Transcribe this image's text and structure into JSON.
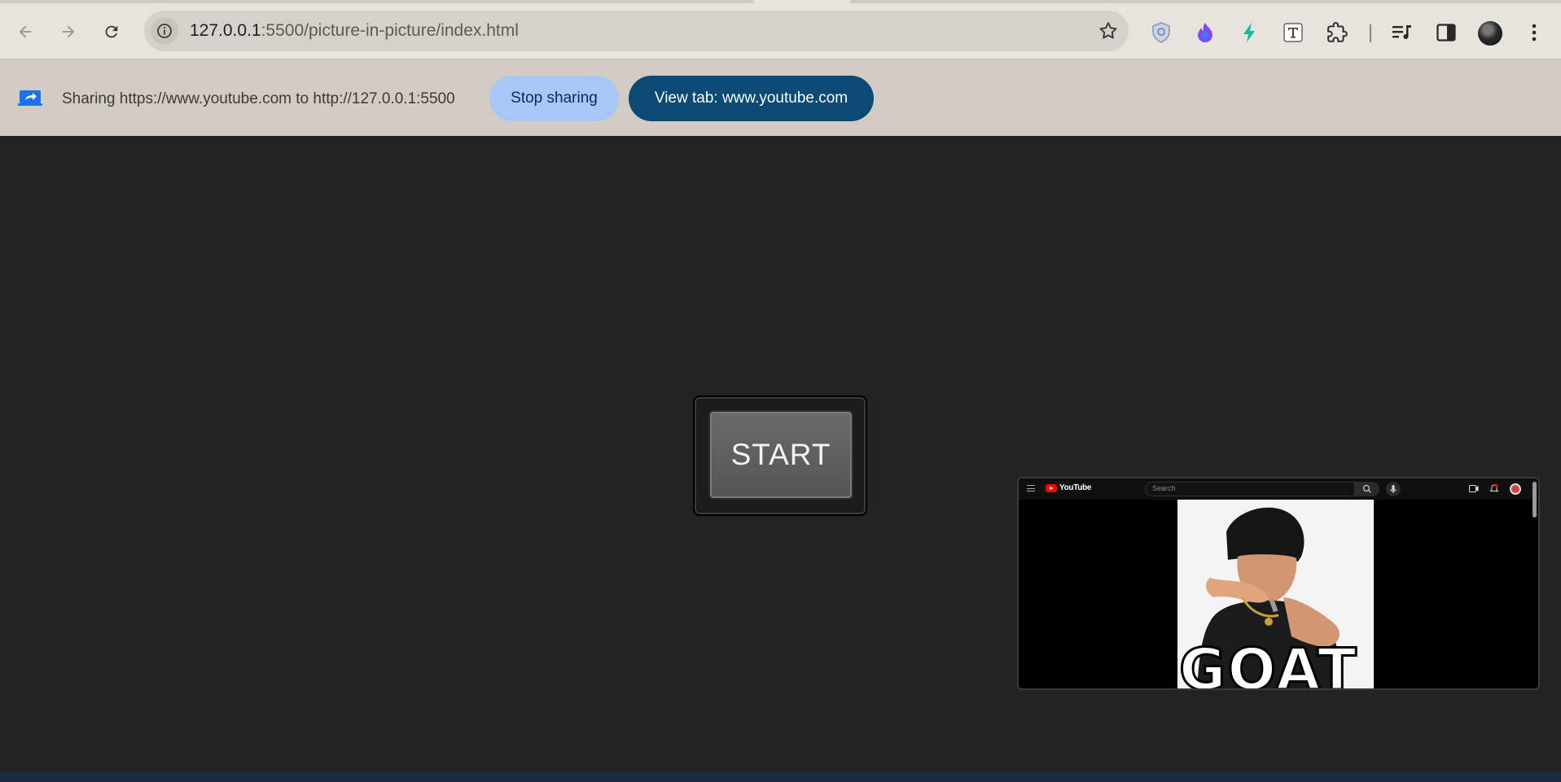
{
  "browser": {
    "url_host": "127.0.0.1",
    "url_rest": ":5500/picture-in-picture/index.html"
  },
  "infobar": {
    "sharing_text": "Sharing https://www.youtube.com to http://127.0.0.1:5500",
    "stop_label": "Stop sharing",
    "view_label": "View tab: www.youtube.com"
  },
  "main": {
    "start_label": "START"
  },
  "pip": {
    "yt_brand": "YouTube",
    "yt_search_placeholder": "Search",
    "thumbnail_text": "GOAT"
  },
  "icons": [
    "back-icon",
    "forward-icon",
    "reload-icon",
    "info-icon",
    "star-icon",
    "shield-extension-icon",
    "flame-extension-icon",
    "bolt-extension-icon",
    "font-extension-icon",
    "puzzle-extensions-icon",
    "media-queue-icon",
    "sidepanel-icon",
    "more-icon",
    "screen-share-icon"
  ],
  "colors": {
    "page_bg": "#232323",
    "toolbar_bg": "#e7e3dd",
    "infobar_bg": "#d2ccc4",
    "stop_btn": "#a9c7f5",
    "view_btn": "#0a4a75"
  }
}
